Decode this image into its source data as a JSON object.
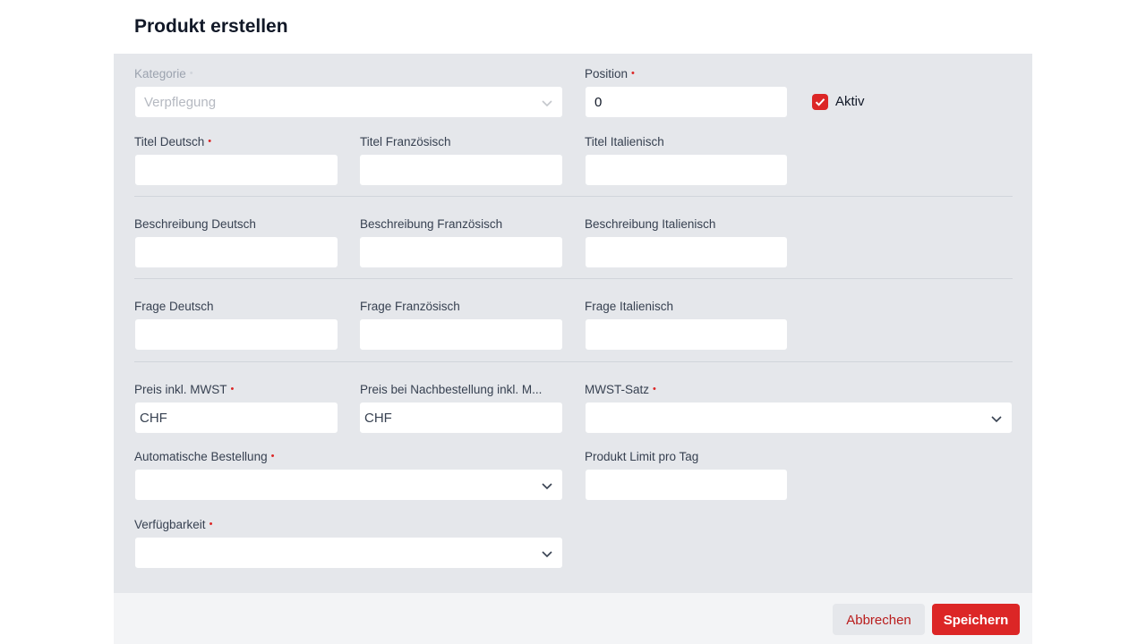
{
  "dialog": {
    "title": "Produkt erstellen"
  },
  "form": {
    "category": {
      "label": "Kategorie",
      "value": "Verpflegung"
    },
    "position": {
      "label": "Position",
      "value": "0"
    },
    "active": {
      "label": "Aktiv",
      "checked": true
    },
    "title_de": {
      "label": "Titel Deutsch",
      "value": ""
    },
    "title_fr": {
      "label": "Titel Französisch",
      "value": ""
    },
    "title_it": {
      "label": "Titel Italienisch",
      "value": ""
    },
    "desc_de": {
      "label": "Beschreibung Deutsch",
      "value": ""
    },
    "desc_fr": {
      "label": "Beschreibung Französisch",
      "value": ""
    },
    "desc_it": {
      "label": "Beschreibung Italienisch",
      "value": ""
    },
    "question_de": {
      "label": "Frage Deutsch",
      "value": ""
    },
    "question_fr": {
      "label": "Frage Französisch",
      "value": ""
    },
    "question_it": {
      "label": "Frage Italienisch",
      "value": ""
    },
    "price": {
      "label": "Preis inkl. MWST",
      "prefix": "CHF"
    },
    "reorder_price": {
      "label": "Preis bei Nachbestellung inkl. M...",
      "prefix": "CHF"
    },
    "vat_rate": {
      "label": "MWST-Satz",
      "value": ""
    },
    "auto_order": {
      "label": "Automatische Bestellung",
      "value": ""
    },
    "daily_limit": {
      "label": "Produkt Limit pro Tag",
      "value": ""
    },
    "availability": {
      "label": "Verfügbarkeit",
      "value": ""
    },
    "required_marker": "•"
  },
  "footer": {
    "cancel_label": "Abbrechen",
    "save_label": "Speichern"
  },
  "colors": {
    "accent": "#dc2626",
    "body_bg": "#e5e7eb",
    "footer_bg": "#f3f4f6"
  }
}
